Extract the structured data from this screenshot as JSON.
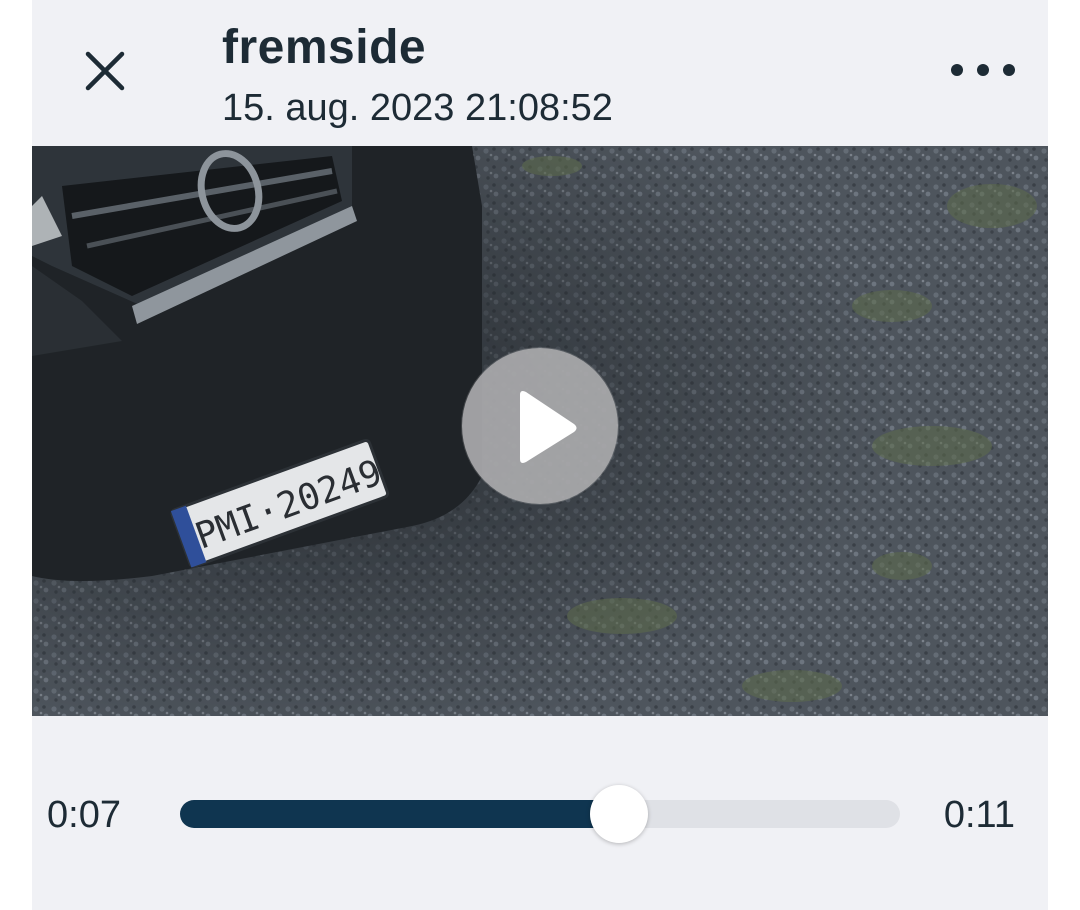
{
  "header": {
    "title": "fremside",
    "timestamp": "15. aug. 2023 21:08:52",
    "close_icon": "close-icon",
    "menu_icon": "more-horizontal-icon"
  },
  "video": {
    "plate_text": "PMI·20249",
    "play_icon": "play-icon"
  },
  "player": {
    "current_time": "0:07",
    "total_time": "0:11",
    "progress_fraction": 0.61
  },
  "colors": {
    "background": "#f0f1f5",
    "text": "#1d2b35",
    "accent": "#0f3550",
    "track": "#dfe1e6"
  }
}
